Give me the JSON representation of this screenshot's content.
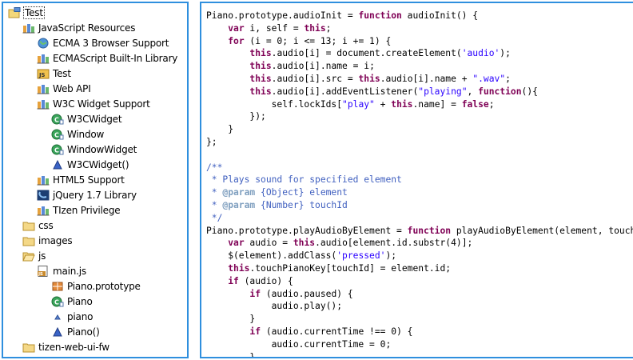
{
  "explorer": {
    "items": [
      {
        "label": "Test",
        "icon": "project-folder-icon"
      },
      {
        "label": "JavaScript Resources",
        "icon": "library-icon"
      },
      {
        "label": "ECMA 3 Browser Support",
        "icon": "globe-icon"
      },
      {
        "label": "ECMAScript Built-In Library",
        "icon": "library-icon"
      },
      {
        "label": "Test",
        "icon": "js-project-icon"
      },
      {
        "label": "Web API",
        "icon": "library-icon"
      },
      {
        "label": "W3C Widget Support",
        "icon": "library-icon"
      },
      {
        "label": "W3CWidget",
        "icon": "class-icon"
      },
      {
        "label": "Window",
        "icon": "class-icon"
      },
      {
        "label": "WindowWidget",
        "icon": "class-icon"
      },
      {
        "label": "W3CWidget()",
        "icon": "function-icon"
      },
      {
        "label": "HTML5 Support",
        "icon": "library-icon"
      },
      {
        "label": "jQuery 1.7 Library",
        "icon": "jquery-icon"
      },
      {
        "label": "TIzen Privilege",
        "icon": "library-icon"
      },
      {
        "label": "css",
        "icon": "folder-icon"
      },
      {
        "label": "images",
        "icon": "folder-icon"
      },
      {
        "label": "js",
        "icon": "folder-open-icon"
      },
      {
        "label": "main.js",
        "icon": "js-file-icon"
      },
      {
        "label": "Piano.prototype",
        "icon": "prototype-icon"
      },
      {
        "label": "Piano",
        "icon": "class-icon"
      },
      {
        "label": "piano",
        "icon": "field-icon"
      },
      {
        "label": "Piano()",
        "icon": "function-icon"
      },
      {
        "label": "tizen-web-ui-fw",
        "icon": "folder-icon"
      }
    ]
  },
  "editor": {
    "lines": [
      [
        [
          "",
          "Piano.prototype.audioInit = "
        ],
        [
          "kw",
          "function"
        ],
        [
          "",
          " audioInit() {"
        ]
      ],
      [
        [
          "",
          "    "
        ],
        [
          "kw",
          "var"
        ],
        [
          "",
          " i, self = "
        ],
        [
          "kw",
          "this"
        ],
        [
          "",
          ";"
        ]
      ],
      [
        [
          "",
          "    "
        ],
        [
          "kw",
          "for"
        ],
        [
          "",
          " (i = 0; i <= 13; i += 1) {"
        ]
      ],
      [
        [
          "",
          "        "
        ],
        [
          "kw",
          "this"
        ],
        [
          "",
          ".audio[i] = document.createElement("
        ],
        [
          "str",
          "'audio'"
        ],
        [
          "",
          ");"
        ]
      ],
      [
        [
          "",
          "        "
        ],
        [
          "kw",
          "this"
        ],
        [
          "",
          ".audio[i].name = i;"
        ]
      ],
      [
        [
          "",
          "        "
        ],
        [
          "kw",
          "this"
        ],
        [
          "",
          ".audio[i].src = "
        ],
        [
          "kw",
          "this"
        ],
        [
          "",
          ".audio[i].name + "
        ],
        [
          "str",
          "\".wav\""
        ],
        [
          "",
          ";"
        ]
      ],
      [
        [
          "",
          "        "
        ],
        [
          "kw",
          "this"
        ],
        [
          "",
          ".audio[i].addEventListener("
        ],
        [
          "str",
          "\"playing\""
        ],
        [
          "",
          ", "
        ],
        [
          "kw",
          "function"
        ],
        [
          "",
          "(){"
        ]
      ],
      [
        [
          "",
          "            self.lockIds["
        ],
        [
          "str",
          "\"play\""
        ],
        [
          "",
          " + "
        ],
        [
          "kw",
          "this"
        ],
        [
          "",
          ".name] = "
        ],
        [
          "kw",
          "false"
        ],
        [
          "",
          ";"
        ]
      ],
      [
        [
          "",
          "        });"
        ]
      ],
      [
        [
          "",
          "    }"
        ]
      ],
      [
        [
          "",
          "};"
        ]
      ],
      [
        [
          "",
          ""
        ]
      ],
      [
        [
          "cmt",
          "/**"
        ]
      ],
      [
        [
          "cmt",
          " * Plays sound for specified element"
        ]
      ],
      [
        [
          "cmt",
          " * "
        ],
        [
          "tag",
          "@param"
        ],
        [
          "cmt",
          " {Object} element"
        ]
      ],
      [
        [
          "cmt",
          " * "
        ],
        [
          "tag",
          "@param"
        ],
        [
          "cmt",
          " {Number} touchId"
        ]
      ],
      [
        [
          "cmt",
          " */"
        ]
      ],
      [
        [
          "",
          "Piano.prototype.playAudioByElement = "
        ],
        [
          "kw",
          "function"
        ],
        [
          "",
          " playAudioByElement(element, touchId) {"
        ]
      ],
      [
        [
          "",
          "    "
        ],
        [
          "kw",
          "var"
        ],
        [
          "",
          " audio = "
        ],
        [
          "kw",
          "this"
        ],
        [
          "",
          ".audio[element.id.substr(4)];"
        ]
      ],
      [
        [
          "",
          "    $(element).addClass("
        ],
        [
          "str",
          "'pressed'"
        ],
        [
          "",
          ");"
        ]
      ],
      [
        [
          "",
          "    "
        ],
        [
          "kw",
          "this"
        ],
        [
          "",
          ".touchPianoKey[touchId] = element.id;"
        ]
      ],
      [
        [
          "",
          "    "
        ],
        [
          "kw",
          "if"
        ],
        [
          "",
          " (audio) {"
        ]
      ],
      [
        [
          "",
          "        "
        ],
        [
          "kw",
          "if"
        ],
        [
          "",
          " (audio.paused) {"
        ]
      ],
      [
        [
          "",
          "            audio.play();"
        ]
      ],
      [
        [
          "",
          "        }"
        ]
      ],
      [
        [
          "",
          "        "
        ],
        [
          "kw",
          "if"
        ],
        [
          "",
          " (audio.currentTime !== 0) {"
        ]
      ],
      [
        [
          "",
          "            audio.currentTime = 0;"
        ]
      ],
      [
        [
          "",
          "        }"
        ]
      ]
    ]
  }
}
